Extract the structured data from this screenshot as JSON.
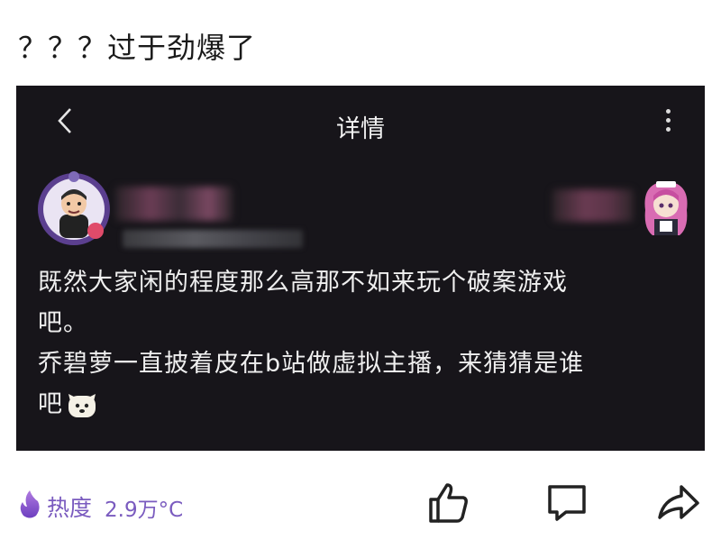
{
  "post": {
    "title": "？？？过于劲爆了"
  },
  "screenshot": {
    "nav": {
      "title": "详情",
      "back_icon": "chevron-left-icon",
      "more_icon": "more-vertical-icon"
    },
    "content": {
      "line1": "既然大家闲的程度那么高那不如来玩个破案游戏",
      "line2": "吧。",
      "line3": "乔碧萝一直披着皮在b站做虚拟主播，来猜猜是谁",
      "line4": "吧"
    }
  },
  "footer": {
    "heat_label": "热度",
    "heat_value": "2.9万°C",
    "icons": [
      "flame-icon",
      "thumbs-up-icon",
      "comment-icon",
      "share-icon"
    ],
    "accent": "#7a5bbf"
  }
}
